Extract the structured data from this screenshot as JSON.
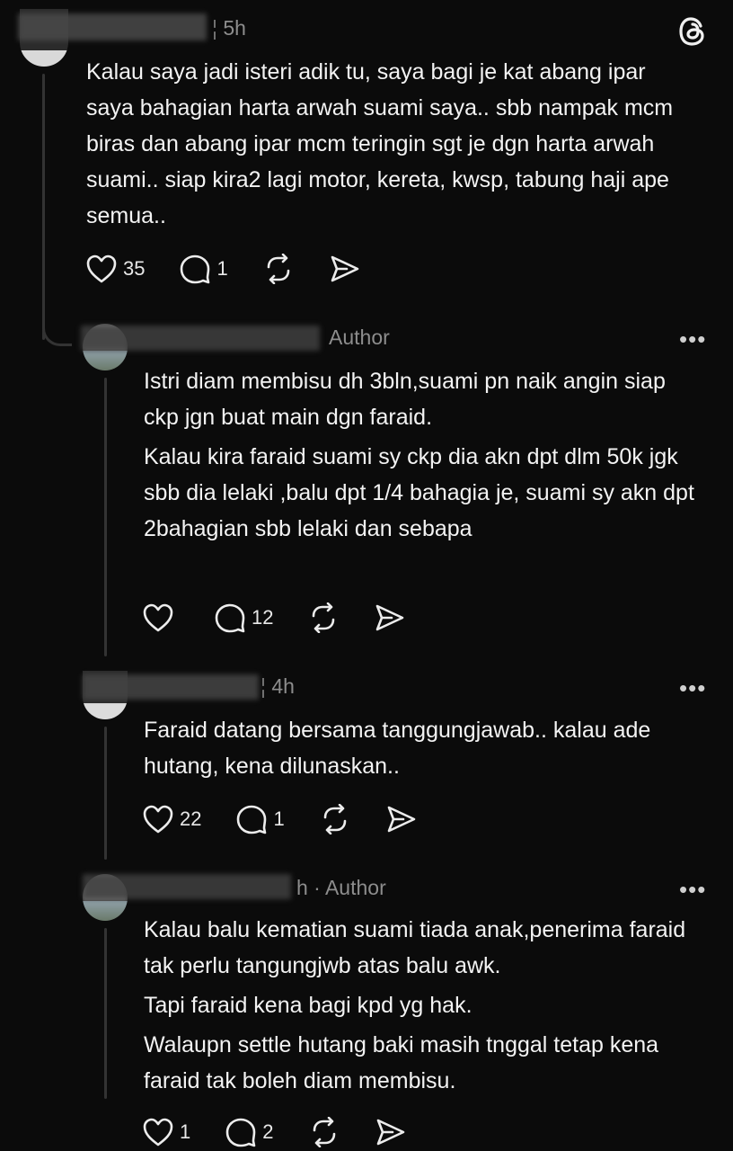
{
  "app": {
    "logo_icon": "threads-logo-icon"
  },
  "comments": [
    {
      "time": "5h",
      "author_tag": "",
      "text": [
        "Kalau saya jadi isteri adik tu, saya bagi je kat abang ipar saya bahagian harta arwah suami saya.. sbb nampak mcm biras dan abang ipar mcm teringin sgt je dgn harta arwah suami.. siap kira2 lagi motor, kereta, kwsp, tabung haji ape semua.."
      ],
      "likes": "35",
      "replies": "1"
    },
    {
      "time": "",
      "author_tag": "Author",
      "text": [
        "Istri diam membisu dh 3bln,suami pn naik angin siap ckp jgn buat main dgn faraid.",
        "Kalau kira faraid suami sy ckp dia akn dpt dlm 50k jgk sbb dia lelaki ,balu dpt 1/4 bahagia je, suami sy akn dpt 2bahagian sbb lelaki dan sebapa"
      ],
      "likes": "",
      "replies": "12"
    },
    {
      "time": "4h",
      "author_tag": "",
      "text": [
        "Faraid datang bersama tanggungjawab.. kalau ade hutang, kena dilunaskan.."
      ],
      "likes": "22",
      "replies": "1"
    },
    {
      "time": "h · Author",
      "author_tag": "",
      "text": [
        "Kalau balu kematian suami tiada anak,penerima faraid tak perlu tangungjwb atas balu awk.",
        "Tapi faraid kena bagi kpd yg hak.",
        "Walaupn settle hutang baki masih tnggal tetap kena faraid tak boleh diam membisu."
      ],
      "likes": "1",
      "replies": "2"
    }
  ],
  "more_label": "•••"
}
